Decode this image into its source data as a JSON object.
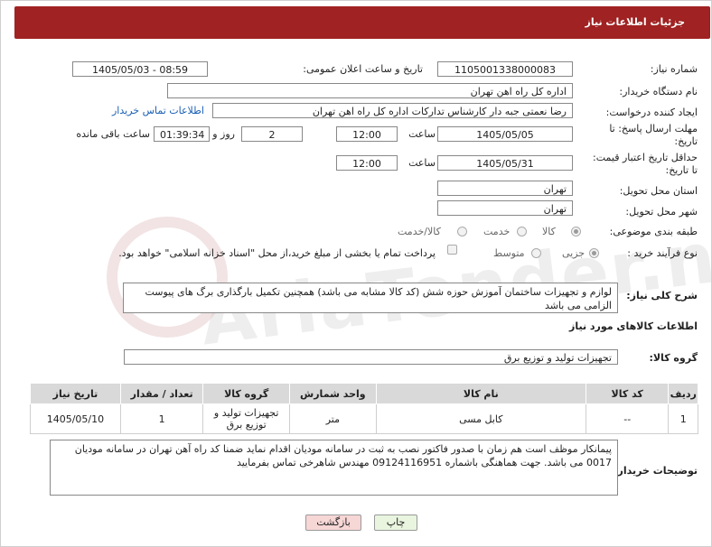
{
  "header": {
    "title": "جزئیات اطلاعات نیاز"
  },
  "form": {
    "need_number_label": "شماره نیاز:",
    "need_number": "1105001338000083",
    "announce_label": "تاریخ و ساعت اعلان عمومی:",
    "announce_value": "1405/05/03 - 08:59",
    "buyer_org_label": "نام دستگاه خریدار:",
    "buyer_org": "اداره کل راه اهن تهران",
    "creator_label": "ایجاد کننده درخواست:",
    "creator": "رضا نعمتی جبه دار کارشناس تدارکات اداره کل راه اهن تهران",
    "contact_link": "اطلاعات تماس خریدار",
    "reply_deadline_label_1": "مهلت ارسال پاسخ: تا",
    "reply_deadline_label_2": "تاریخ:",
    "reply_date": "1405/05/05",
    "time_label": "ساعت",
    "reply_time": "12:00",
    "days_value": "2",
    "days_label": "روز و",
    "remaining_value": "01:39:34",
    "remaining_label": "ساعت باقی مانده",
    "price_validity_label_1": "حداقل تاریخ اعتبار قیمت:",
    "price_validity_label_2": "تا تاریخ:",
    "price_date": "1405/05/31",
    "price_time": "12:00",
    "province_label": "استان محل تحویل:",
    "province": "تهران",
    "city_label": "شهر محل تحویل:",
    "city": "تهران",
    "category_label": "طبقه بندی موضوعی:",
    "category_options": [
      "کالا",
      "خدمت",
      "کالا/خدمت"
    ],
    "process_label": "نوع فرآیند خرید :",
    "process_options": [
      "جزیی",
      "متوسط"
    ],
    "payment_note": "پرداخت تمام یا بخشی از مبلغ خرید،از محل \"اسناد خزانه اسلامی\" خواهد بود."
  },
  "description": {
    "label": "شرح کلی نیاز:",
    "text": "لوازم  و تجهیزات ساختمان آموزش حوزه شش (کد کالا مشابه می باشد) همچنین تکمیل بارگذاری برگ های پیوست الزامی می باشد"
  },
  "goods": {
    "section_title": "اطلاعات کالاهای مورد نیاز",
    "group_label": "گروه کالا:",
    "group_value": "تجهیزات تولید و توزیع برق",
    "columns": [
      "ردیف",
      "کد کالا",
      "نام کالا",
      "واحد شمارش",
      "گروه کالا",
      "تعداد / مقدار",
      "تاریخ نیاز"
    ],
    "rows": [
      {
        "row": "1",
        "code": "--",
        "name": "کابل مسی",
        "unit": "متر",
        "group": "تجهیزات تولید و توزیع برق",
        "qty": "1",
        "date": "1405/05/10"
      }
    ]
  },
  "buyer_notes": {
    "label": "توضیحات خریدار:",
    "text": "پیمانکار موظف است هم زمان با صدور فاکتور نصب به ثبت در سامانه مودیان اقدام نماید ضمنا کد راه آهن تهران در سامانه مودیان 0017 می باشد. جهت هماهنگی باشماره 09124116951 مهندس شاهرخی تماس بفرمایید"
  },
  "buttons": {
    "print": "چاپ",
    "back": "بازگشت"
  },
  "colors": {
    "header_bg": "#a02222",
    "back_button": "#f7d6d6",
    "print_button": "#e9f5df",
    "link": "#1a5fb4"
  }
}
